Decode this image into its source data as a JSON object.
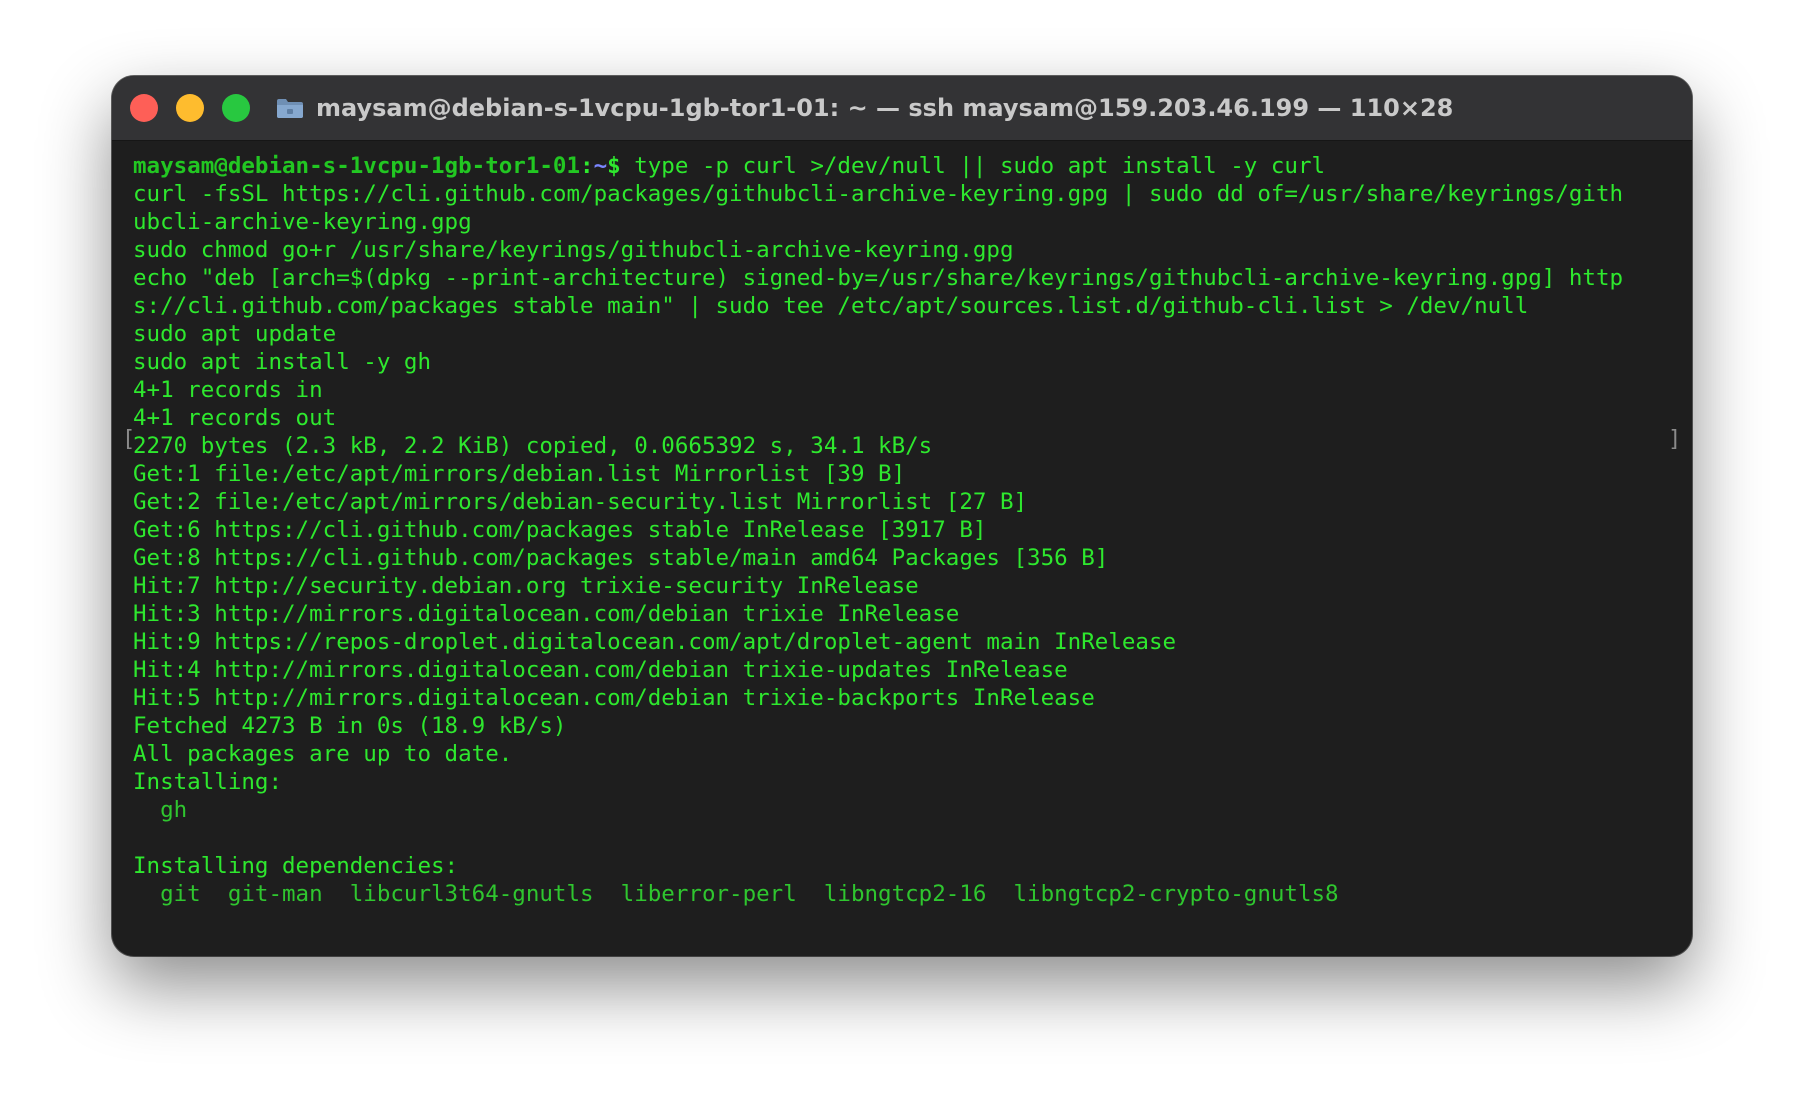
{
  "window": {
    "title": "maysam@debian-s-1vcpu-1gb-tor1-01: ~ — ssh maysam@159.203.46.199 — 110×28",
    "folder_icon": "folder-icon",
    "buttons": {
      "close": "close-button",
      "minimize": "minimize-button",
      "zoom": "zoom-button"
    }
  },
  "prompt": {
    "user_host": "maysam@debian-s-1vcpu-1gb-tor1-01",
    "sep": ":",
    "path": "~",
    "symbol": "$",
    "command": " type -p curl >/dev/null || sudo apt install -y curl"
  },
  "lines": [
    "curl -fsSL https://cli.github.com/packages/githubcli-archive-keyring.gpg | sudo dd of=/usr/share/keyrings/gith",
    "ubcli-archive-keyring.gpg",
    "sudo chmod go+r /usr/share/keyrings/githubcli-archive-keyring.gpg",
    "echo \"deb [arch=$(dpkg --print-architecture) signed-by=/usr/share/keyrings/githubcli-archive-keyring.gpg] http",
    "s://cli.github.com/packages stable main\" | sudo tee /etc/apt/sources.list.d/github-cli.list > /dev/null",
    "sudo apt update",
    "sudo apt install -y gh",
    "4+1 records in",
    "4+1 records out",
    "2270 bytes (2.3 kB, 2.2 KiB) copied, 0.0665392 s, 34.1 kB/s",
    "Get:1 file:/etc/apt/mirrors/debian.list Mirrorlist [39 B]",
    "Get:2 file:/etc/apt/mirrors/debian-security.list Mirrorlist [27 B]",
    "Get:6 https://cli.github.com/packages stable InRelease [3917 B]",
    "Get:8 https://cli.github.com/packages stable/main amd64 Packages [356 B]",
    "Hit:7 http://security.debian.org trixie-security InRelease",
    "Hit:3 http://mirrors.digitalocean.com/debian trixie InRelease",
    "Hit:9 https://repos-droplet.digitalocean.com/apt/droplet-agent main InRelease",
    "Hit:4 http://mirrors.digitalocean.com/debian trixie-updates InRelease",
    "Hit:5 http://mirrors.digitalocean.com/debian trixie-backports InRelease",
    "Fetched 4273 B in 0s (18.9 kB/s)",
    "All packages are up to date.",
    "Installing:",
    "  gh",
    "",
    "Installing dependencies:",
    "  git  git-man  libcurl3t64-gnutls  liberror-perl  libngtcp2-16  libngtcp2-crypto-gnutls8"
  ],
  "selection_brackets": {
    "left": "[",
    "right": "]"
  },
  "colors": {
    "terminal_bg": "#1e1e1e",
    "terminal_fg": "#2ee82e",
    "prompt_path": "#7a86ff",
    "titlebar_bg": "#333335"
  }
}
